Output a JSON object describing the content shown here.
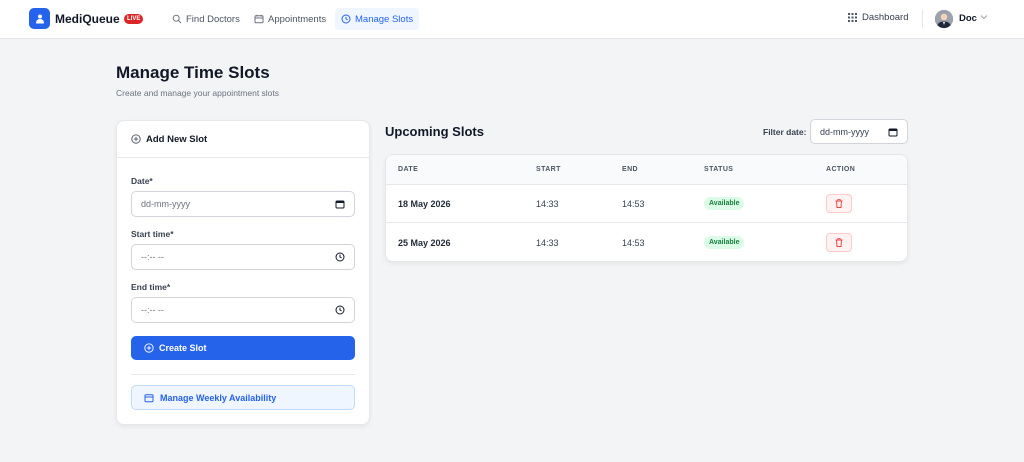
{
  "navbar": {
    "brand": "MediQueue",
    "live_badge": "LIVE",
    "links": [
      {
        "label": "Find Doctors",
        "icon": "search-icon"
      },
      {
        "label": "Appointments",
        "icon": "calendar-icon"
      },
      {
        "label": "Manage Slots",
        "icon": "clock-icon",
        "active": true
      }
    ],
    "dashboard_label": "Dashboard",
    "user_name": "Doc"
  },
  "page": {
    "title": "Manage Time Slots",
    "subtitle": "Create and manage your appointment slots"
  },
  "form": {
    "header": "Add New Slot",
    "date_label": "Date*",
    "date_placeholder": "dd-mm-yyyy",
    "start_label": "Start time*",
    "start_placeholder": "--:-- --",
    "end_label": "End time*",
    "end_placeholder": "--:-- --",
    "create_button": "Create Slot",
    "weekly_button": "Manage Weekly Availability"
  },
  "slots": {
    "title": "Upcoming Slots",
    "filter_label": "Filter date:",
    "filter_placeholder": "dd-mm-yyyy",
    "columns": [
      "DATE",
      "START",
      "END",
      "STATUS",
      "ACTION"
    ],
    "rows": [
      {
        "date": "18 May 2026",
        "start": "14:33",
        "end": "14:53",
        "status": "Available"
      },
      {
        "date": "25 May 2026",
        "start": "14:33",
        "end": "14:53",
        "status": "Available"
      }
    ]
  },
  "colors": {
    "primary": "#2563eb",
    "live": "#dc2626",
    "available_bg": "#dcfce7",
    "available_text": "#15803d",
    "delete": "#ef4444"
  }
}
